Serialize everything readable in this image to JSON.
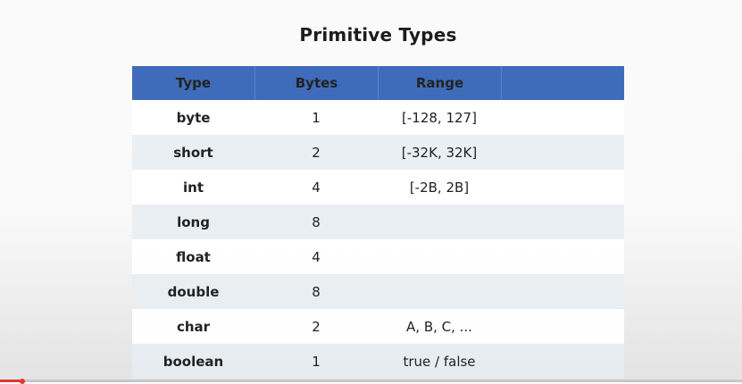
{
  "title": "Primitive Types",
  "table": {
    "headers": [
      "Type",
      "Bytes",
      "Range",
      ""
    ],
    "rows": [
      {
        "type": "byte",
        "bytes": "1",
        "range": "[-128, 127]"
      },
      {
        "type": "short",
        "bytes": "2",
        "range": "[-32K, 32K]"
      },
      {
        "type": "int",
        "bytes": "4",
        "range": "[-2B, 2B]"
      },
      {
        "type": "long",
        "bytes": "8",
        "range": ""
      },
      {
        "type": "float",
        "bytes": "4",
        "range": ""
      },
      {
        "type": "double",
        "bytes": "8",
        "range": ""
      },
      {
        "type": "char",
        "bytes": "2",
        "range": "A, B, C, ..."
      },
      {
        "type": "boolean",
        "bytes": "1",
        "range": "true / false"
      }
    ]
  },
  "colors": {
    "header_bg": "#3e6cba",
    "progress": "#e53935"
  },
  "video": {
    "progress_fraction": 0.03
  }
}
